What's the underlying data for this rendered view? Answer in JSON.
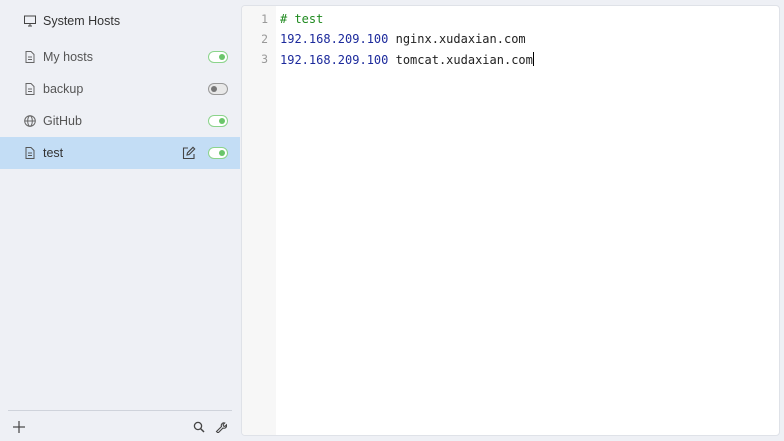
{
  "sidebar": {
    "system_hosts": {
      "label": "System Hosts",
      "icon": "monitor-icon"
    },
    "items": [
      {
        "label": "My hosts",
        "icon": "file-icon",
        "enabled": true
      },
      {
        "label": "backup",
        "icon": "file-icon",
        "enabled": false
      },
      {
        "label": "GitHub",
        "icon": "globe-icon",
        "enabled": true
      },
      {
        "label": "test",
        "icon": "file-icon",
        "enabled": true,
        "selected": true
      }
    ]
  },
  "editor": {
    "lines": [
      {
        "num": "1",
        "comment": "# test"
      },
      {
        "num": "2",
        "ip": "192.168.209.100",
        "host": " nginx.xudaxian.com"
      },
      {
        "num": "3",
        "ip": "192.168.209.100",
        "host": " tomcat.xudaxian.com"
      }
    ]
  },
  "colors": {
    "accent_selected": "#c3ddf5",
    "toggle_on": "#6ac56a",
    "comment": "#1f8a1f",
    "ip": "#1c2a9c"
  }
}
